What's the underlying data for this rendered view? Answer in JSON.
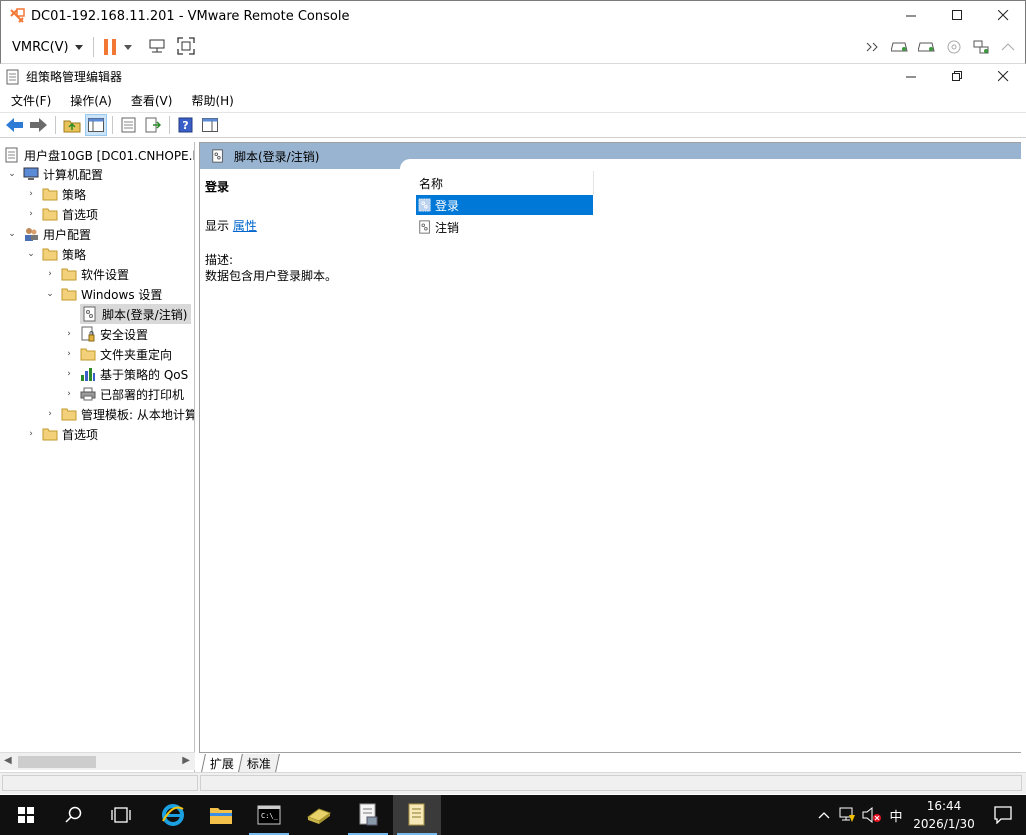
{
  "vmrc": {
    "title": "DC01-192.168.11.201 - VMware Remote Console",
    "menu_label": "VMRC(V)",
    "colors": {
      "pause": "#f27735",
      "accent": "#0078d7"
    }
  },
  "gpme": {
    "title": "组策略管理编辑器",
    "menu": [
      "文件(F)",
      "操作(A)",
      "查看(V)",
      "帮助(H)"
    ]
  },
  "tree": {
    "items": [
      {
        "label": "用户盘10GB [DC01.CNHOPE.l",
        "icon": "gpo-icon",
        "expander": ""
      },
      {
        "label": "计算机配置",
        "icon": "computer-icon",
        "expander": "open"
      },
      {
        "label": "策略",
        "icon": "folder-icon",
        "expander": "closed"
      },
      {
        "label": "首选项",
        "icon": "folder-icon",
        "expander": "closed"
      },
      {
        "label": "用户配置",
        "icon": "users-icon",
        "expander": "open"
      },
      {
        "label": "策略",
        "icon": "folder-icon",
        "expander": "open"
      },
      {
        "label": "软件设置",
        "icon": "folder-icon",
        "expander": "closed"
      },
      {
        "label": "Windows 设置",
        "icon": "folder-icon",
        "expander": "open"
      },
      {
        "label": "脚本(登录/注销)",
        "icon": "script-icon",
        "expander": "",
        "selected": true
      },
      {
        "label": "安全设置",
        "icon": "security-icon",
        "expander": "closed"
      },
      {
        "label": "文件夹重定向",
        "icon": "folder-icon",
        "expander": "closed"
      },
      {
        "label": "基于策略的 QoS",
        "icon": "qos-chart-icon",
        "expander": "closed"
      },
      {
        "label": "已部署的打印机",
        "icon": "printer-icon",
        "expander": "closed"
      },
      {
        "label": "管理模板: 从本地计算",
        "icon": "folder-icon",
        "expander": "closed"
      },
      {
        "label": "首选项",
        "icon": "folder-icon",
        "expander": "closed"
      }
    ]
  },
  "right": {
    "header": "脚本(登录/注销)",
    "detail_title": "登录",
    "show_label": "显示",
    "properties_link": "属性",
    "desc_label": "描述:",
    "desc_text": "数据包含用户登录脚本。",
    "column_name": "名称",
    "items": [
      "登录",
      "注销"
    ],
    "tabs": [
      "扩展",
      "标准"
    ]
  },
  "taskbar": {
    "time": "16:44",
    "date": "2026/1/30",
    "ime": "中"
  }
}
